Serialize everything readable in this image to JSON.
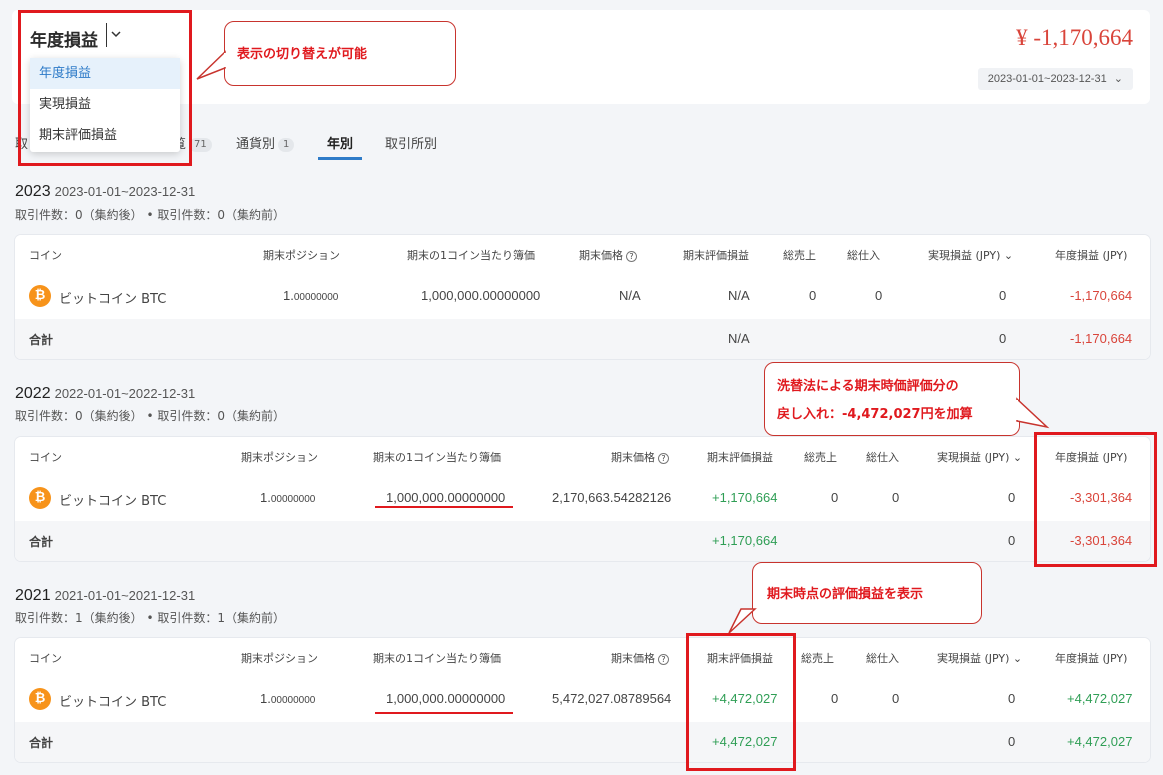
{
  "header": {
    "selector_label": "年度損益",
    "dropdown_options": [
      "年度損益",
      "実現損益",
      "期末評価損益"
    ],
    "total_value": "¥ -1,170,664",
    "date_range": "2023-01-01~2023-12-31"
  },
  "tabs": [
    {
      "label": "取",
      "count": ""
    },
    {
      "label": "覧",
      "count": "71"
    },
    {
      "label": "通貨別",
      "count": "1"
    },
    {
      "label": "年別",
      "count": ""
    },
    {
      "label": "取引所別",
      "count": ""
    }
  ],
  "columns": {
    "coin": "コイン",
    "position": "期末ポジション",
    "book_price": "期末の1コイン当たり簿価",
    "end_price": "期末価格",
    "eval": "期末評価損益",
    "sales": "総売上",
    "purchase": "総仕入",
    "realized": "実現損益 (JPY)",
    "annual": "年度損益 (JPY)"
  },
  "years": [
    {
      "year": "2023",
      "range": "2023-01-01~2023-12-31",
      "summary": "取引件数：0（集約後） • 取引件数：0（集約前）",
      "coin_symbol": "₿",
      "coin_name": "ビットコイン BTC",
      "position_int": "1.",
      "position_dec": "00000000",
      "book_price": "1,000,000.00000000",
      "end_price": "N/A",
      "eval": "N/A",
      "sales": "0",
      "purchase": "0",
      "realized": "0",
      "annual": "-1,170,664",
      "total_label": "合計",
      "total_eval": "N/A",
      "total_realized": "0",
      "total_annual": "-1,170,664"
    },
    {
      "year": "2022",
      "range": "2022-01-01~2022-12-31",
      "summary": "取引件数：0（集約後） • 取引件数：0（集約前）",
      "coin_symbol": "₿",
      "coin_name": "ビットコイン BTC",
      "position_int": "1.",
      "position_dec": "00000000",
      "book_price": "1,000,000.00000000",
      "end_price": "2,170,663.54282126",
      "eval": "+1,170,664",
      "sales": "0",
      "purchase": "0",
      "realized": "0",
      "annual": "-3,301,364",
      "total_label": "合計",
      "total_eval": "+1,170,664",
      "total_realized": "0",
      "total_annual": "-3,301,364"
    },
    {
      "year": "2021",
      "range": "2021-01-01~2021-12-31",
      "summary": "取引件数：1（集約後） • 取引件数：1（集約前）",
      "coin_symbol": "₿",
      "coin_name": "ビットコイン BTC",
      "position_int": "1.",
      "position_dec": "00000000",
      "book_price": "1,000,000.00000000",
      "end_price": "5,472,027.08789564",
      "eval": "+4,472,027",
      "sales": "0",
      "purchase": "0",
      "realized": "0",
      "annual": "+4,472,027",
      "total_label": "合計",
      "total_eval": "+4,472,027",
      "total_realized": "0",
      "total_annual": "+4,472,027"
    }
  ],
  "annotations": {
    "switch_note": "表示の切り替えが可能",
    "reversal_line1": "洗替法による期末時価評価分の",
    "reversal_line2": "戻し入れ：-4,472,027円を加算",
    "eval_note": "期末時点の評価損益を表示"
  },
  "colors": {
    "negative": "#d9443a",
    "positive": "#2f9e55",
    "accent": "#2e7bc8",
    "annotation_red": "#e0191e"
  }
}
